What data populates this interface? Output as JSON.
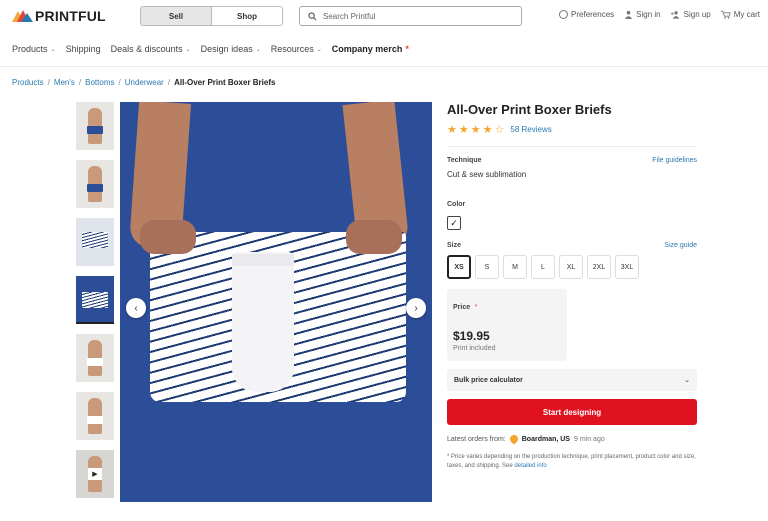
{
  "header": {
    "logo_text": "PRINTFUL",
    "segment": {
      "sell": "Sell",
      "shop": "Shop"
    },
    "search_placeholder": "Search Printful",
    "preferences": "Preferences",
    "sign_in": "Sign in",
    "sign_up": "Sign up",
    "cart": "My cart"
  },
  "nav": {
    "items": [
      "Products",
      "Shipping",
      "Deals & discounts",
      "Design ideas",
      "Resources"
    ],
    "company": "Company merch",
    "company_star": "*"
  },
  "breadcrumb": {
    "items": [
      "Products",
      "Men's",
      "Bottoms",
      "Underwear"
    ],
    "current": "All-Over Print Boxer Briefs",
    "separator": "/"
  },
  "product": {
    "title": "All-Over Print Boxer Briefs",
    "rating": 4,
    "reviews": "58 Reviews",
    "technique_label": "Technique",
    "file_guidelines": "File guidelines",
    "technique_value": "Cut & sew sublimation",
    "color_label": "Color",
    "size_label": "Size",
    "size_guide": "Size guide",
    "sizes": [
      "XS",
      "S",
      "M",
      "L",
      "XL",
      "2XL",
      "3XL"
    ],
    "selected_size": "XS",
    "price_label": "Price",
    "price_req": "*",
    "price": "$19.95",
    "price_note": "Print included",
    "bulk": "Bulk price calculator",
    "cta": "Start designing",
    "orders_label": "Latest orders from:",
    "orders_city": "Boardman, US",
    "orders_ago": "9 min ago",
    "footnote": "* Price varies depending on the production technique, print placement, product color and size, taxes, and shipping. See",
    "footnote_link": "detailed info"
  },
  "colors": {
    "accent_red": "#e0121f",
    "link_blue": "#2a7ab0",
    "star": "#f3a52b",
    "photo_bg": "#2c4d98"
  }
}
